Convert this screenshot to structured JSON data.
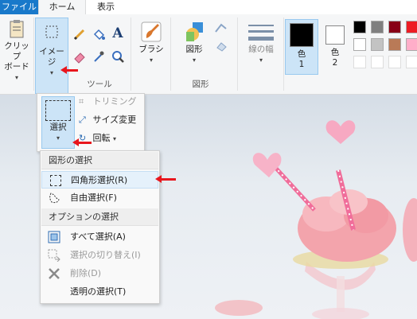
{
  "menu_tabs": {
    "file": "ファイル",
    "home": "ホーム",
    "view": "表示"
  },
  "clipboard": {
    "label": "クリップ\nボード",
    "caret": "▾"
  },
  "image_group": {
    "label": "イメージ",
    "caret": "▾"
  },
  "tools_group": {
    "label": "ツール"
  },
  "brushes": {
    "label": "ブラシ",
    "caret": "▾"
  },
  "shapes": {
    "label": "図形",
    "group_label": "図形",
    "caret": "▾"
  },
  "size": {
    "label": "線の幅",
    "caret": "▾"
  },
  "color1": {
    "label": "色",
    "index": "1",
    "color": "#000000"
  },
  "color2": {
    "label": "色",
    "index": "2",
    "color": "#ffffff"
  },
  "palette_row1": [
    "#000000",
    "#7f7f7f",
    "#880015",
    "#ed1c24"
  ],
  "palette_row2": [
    "#ffffff",
    "#c3c3c3",
    "#b97a57",
    "#ffaec9"
  ],
  "image_panel": {
    "select_label": "選択",
    "select_caret": "▾",
    "crop": "トリミング",
    "resize": "サイズ変更",
    "rotate": "回転",
    "rotate_caret": "▾"
  },
  "selection_menu": {
    "shape_header": "図形の選択",
    "rect_select": "四角形選択(R)",
    "free_select": "自由選択(F)",
    "option_header": "オプションの選択",
    "select_all": "すべて選択(A)",
    "invert_select": "選択の切り替え(I)",
    "delete": "削除(D)",
    "transparent_select": "透明の選択(T)"
  },
  "accent_color": "#1979ca",
  "arrow_color": "#e8161d"
}
